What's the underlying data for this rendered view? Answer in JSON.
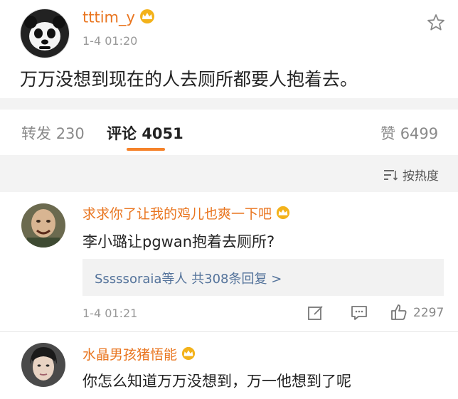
{
  "post": {
    "author": "tttim_y",
    "time": "1-4 01:20",
    "content": "万万没想到现在的人去厕所都要人抱着去。",
    "icons": {
      "avatar": "panda-avatar",
      "badge": "vip-crown-icon",
      "favorite": "star-outline-icon"
    }
  },
  "tabs": {
    "repost": {
      "label": "转发",
      "count": "230"
    },
    "comment": {
      "label": "评论",
      "count": "4051"
    },
    "like": {
      "label": "赞",
      "count": "6499"
    },
    "accent_color": "#f5822a"
  },
  "sort": {
    "label": "按热度",
    "icon": "sort-lines-icon"
  },
  "comments": [
    {
      "author": "求求你了让我的鸡儿也爽一下吧",
      "text": "李小璐让pgwan抱着去厕所?",
      "replies": "Sssssoraia等人  共308条回复 >",
      "time": "1-4 01:21",
      "likes": "2297",
      "icons": {
        "badge": "vip-crown-icon",
        "edit": "edit-icon",
        "comment": "comment-icon",
        "like": "thumbs-up-icon"
      }
    },
    {
      "author": "水晶男孩猪悟能",
      "text": "你怎么知道万万没想到，万一他想到了呢",
      "icons": {
        "badge": "vip-crown-icon"
      }
    }
  ],
  "colors": {
    "username": "#e9751f",
    "meta": "#999999",
    "reply_link": "#54739b",
    "background_band": "#f3f3f3"
  }
}
